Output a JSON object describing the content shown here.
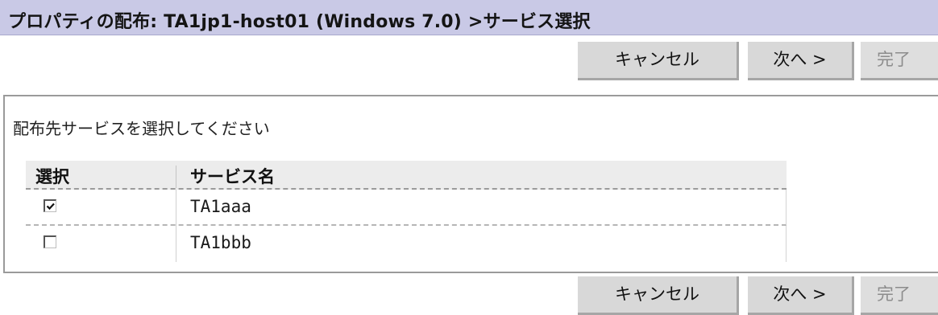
{
  "header": {
    "title": "プロパティの配布: TA1jp1-host01 (Windows 7.0) >サービス選択"
  },
  "buttons": {
    "cancel": "キャンセル",
    "next": "次へ >",
    "finish": "完了"
  },
  "main": {
    "instruction": "配布先サービスを選択してください",
    "table": {
      "columns": [
        "選択",
        "サービス名"
      ],
      "rows": [
        {
          "service_name": "TA1aaa",
          "selected": true
        },
        {
          "service_name": "TA1bbb",
          "selected": false
        }
      ]
    }
  },
  "colors": {
    "title_bar": "#c9c9e6",
    "button_bg": "#d8d8d8"
  }
}
